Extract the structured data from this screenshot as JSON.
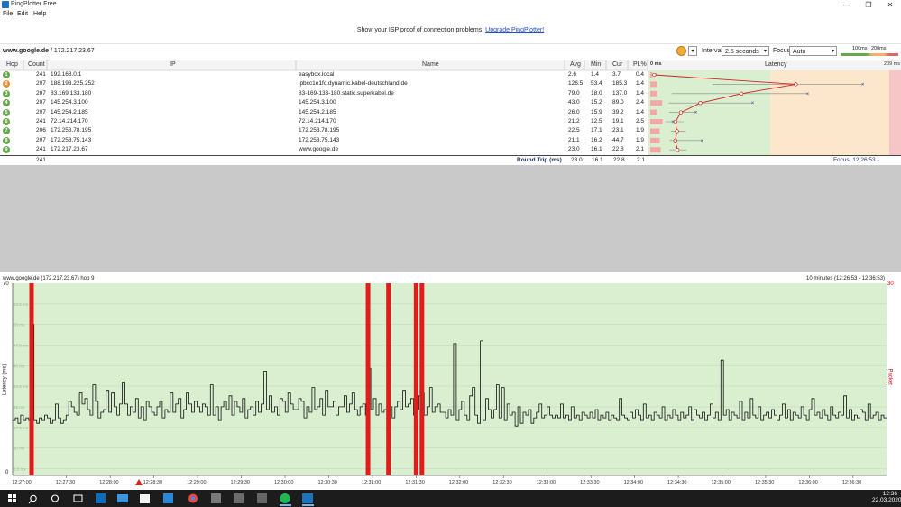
{
  "window": {
    "title": "PingPlotter Free",
    "min_icon": "—",
    "max_icon": "❐",
    "close_icon": "✕"
  },
  "menu": [
    "File",
    "Edit",
    "Help"
  ],
  "banner": {
    "text": "Show your ISP proof of connection problems.",
    "link": "Upgrade PingPlotter!"
  },
  "target": {
    "host": "www.google.de",
    "ip": " / 172.217.23.67"
  },
  "controls": {
    "interval_label": "Interval",
    "interval_value": "2.5 seconds",
    "focus_label": "Focus",
    "focus_value": "Auto",
    "legend_100": "100ms",
    "legend_200": "200ms"
  },
  "columns": {
    "hop": "Hop",
    "count": "Count",
    "ip": "IP",
    "name": "Name",
    "avg": "Avg",
    "min": "Min",
    "cur": "Cur",
    "pl": "PL%",
    "zero": "0 ms",
    "latency": "Latency",
    "max": "209 ms"
  },
  "colors": {
    "good": "#d9efd0",
    "warn": "#fde7cc",
    "bad": "#f6c6c6",
    "hop_green": "#6aa84f",
    "hop_orange": "#e69138",
    "loss": "#e21b1b"
  },
  "hops": [
    {
      "hop": "1",
      "count": "241",
      "ip": "192.168.0.1",
      "name": "easybox.local",
      "avg": "2.6",
      "min": "1.4",
      "cur": "3.7",
      "pl": "0.4",
      "color": "green"
    },
    {
      "hop": "2",
      "count": "207",
      "ip": "188.193.225.252",
      "name": "ipbcc1e1fc.dynamic.kabel-deutschland.de",
      "avg": "126.5",
      "min": "53.4",
      "cur": "185.3",
      "pl": "1.4",
      "color": "orange"
    },
    {
      "hop": "3",
      "count": "207",
      "ip": "83.169.133.180",
      "name": "83-169-133-180.static.superkabel.de",
      "avg": "79.0",
      "min": "18.0",
      "cur": "137.0",
      "pl": "1.4",
      "color": "green"
    },
    {
      "hop": "4",
      "count": "207",
      "ip": "145.254.3.100",
      "name": "145.254.3.100",
      "avg": "43.0",
      "min": "15.2",
      "cur": "89.0",
      "pl": "2.4",
      "color": "green"
    },
    {
      "hop": "5",
      "count": "207",
      "ip": "145.254.2.185",
      "name": "145.254.2.185",
      "avg": "26.0",
      "min": "15.9",
      "cur": "39.2",
      "pl": "1.4",
      "color": "green"
    },
    {
      "hop": "6",
      "count": "241",
      "ip": "72.14.214.170",
      "name": "72.14.214.170",
      "avg": "21.2",
      "min": "12.5",
      "cur": "19.1",
      "pl": "2.5",
      "color": "green"
    },
    {
      "hop": "7",
      "count": "206",
      "ip": "172.253.78.195",
      "name": "172.253.78.195",
      "avg": "22.5",
      "min": "17.1",
      "cur": "23.1",
      "pl": "1.9",
      "color": "green"
    },
    {
      "hop": "8",
      "count": "207",
      "ip": "172.253.75.143",
      "name": "172.253.75.143",
      "avg": "21.1",
      "min": "16.2",
      "cur": "44.7",
      "pl": "1.9",
      "color": "green"
    },
    {
      "hop": "9",
      "count": "241",
      "ip": "172.217.23.67",
      "name": "www.google.de",
      "avg": "23.0",
      "min": "16.1",
      "cur": "22.8",
      "pl": "2.1",
      "color": "green"
    }
  ],
  "roundtrip": {
    "count": "241",
    "label": "Round Trip (ms)",
    "avg": "23.0",
    "min": "16.1",
    "cur": "22.8",
    "pl": "2.1",
    "focus": "Focus: 12:26:53 - 12:36:53"
  },
  "graph": {
    "title": "www.google.de (172.217.23.67) hop 9",
    "range": "10 minutes (12:26:53 - 12:36:53)",
    "ylabel": "Latency (ms)",
    "y2label": "Packet Loss %",
    "ymax_label": "70",
    "ymin_label": "0",
    "y2max_label": "30"
  },
  "chart_data": {
    "type": "line",
    "title": "www.google.de (172.217.23.67) hop 9",
    "ylabel": "Latency (ms)",
    "y2label": "Packet Loss %",
    "ylim": [
      0,
      70
    ],
    "y2lim": [
      0,
      30
    ],
    "grid": true,
    "gridlines": [
      "62.5 ms",
      "55 ms",
      "47.5 ms",
      "40 ms",
      "32.5 ms",
      "25 ms",
      "17.5 ms",
      "10 ms",
      "2.5 ms"
    ],
    "x_ticks": [
      "12:27:00",
      "12:27:30",
      "12:28:00",
      "12:28:30",
      "12:29:00",
      "12:29:30",
      "12:30:00",
      "12:30:30",
      "12:31:00",
      "12:31:30",
      "12:32:00",
      "12:32:30",
      "12:33:00",
      "12:33:30",
      "12:34:00",
      "12:34:30",
      "12:35:00",
      "12:35:30",
      "12:36:00",
      "12:36:30"
    ],
    "loss_events": [
      "12:27:06",
      "12:30:57",
      "12:31:11",
      "12:31:30",
      "12:31:34"
    ],
    "latency": [
      20,
      21,
      19,
      22,
      20,
      21,
      20,
      55,
      20,
      19,
      21,
      20,
      22,
      21,
      19,
      20,
      26,
      21,
      19,
      20,
      22,
      27,
      25,
      23,
      22,
      30,
      26,
      28,
      24,
      22,
      33,
      27,
      21,
      23,
      24,
      31,
      23,
      30,
      25,
      22,
      26,
      34,
      26,
      22,
      25,
      23,
      28,
      21,
      25,
      20,
      27,
      25,
      23,
      22,
      25,
      27,
      21,
      24,
      23,
      30,
      23,
      26,
      28,
      21,
      24,
      30,
      26,
      23,
      27,
      25,
      23,
      26,
      25,
      22,
      33,
      22,
      25,
      20,
      25,
      27,
      24,
      29,
      22,
      27,
      25,
      23,
      28,
      21,
      24,
      25,
      22,
      27,
      23,
      26,
      38,
      24,
      29,
      23,
      25,
      22,
      28,
      27,
      23,
      30,
      26,
      24,
      24,
      28,
      27,
      21,
      25,
      23,
      32,
      24,
      25,
      28,
      22,
      31,
      25,
      25,
      27,
      22,
      25,
      25,
      29,
      23,
      26,
      30,
      24,
      22,
      25,
      26,
      22,
      39,
      24,
      28,
      22,
      26,
      23,
      24,
      29,
      25,
      21,
      25,
      27,
      24,
      31,
      25,
      26,
      28,
      22,
      24,
      29,
      30,
      22,
      25,
      32,
      23,
      25,
      26,
      23,
      23,
      21,
      24,
      22,
      48,
      20,
      24,
      27,
      22,
      20,
      29,
      32,
      22,
      19,
      49,
      20,
      28,
      24,
      21,
      24,
      33,
      21,
      32,
      20,
      26,
      22,
      23,
      18,
      25,
      19,
      23,
      22,
      24,
      19,
      21,
      23,
      26,
      21,
      22,
      25,
      22,
      21,
      22,
      21,
      26,
      21,
      22,
      20,
      25,
      21,
      22,
      20,
      23,
      22,
      21,
      23,
      21,
      24,
      20,
      22,
      21,
      23,
      20,
      22,
      21,
      20,
      28,
      22,
      21,
      20,
      23,
      21,
      24,
      22,
      20,
      26,
      21,
      22,
      20,
      23,
      22,
      21,
      25,
      20,
      22,
      21,
      24,
      22,
      20,
      23,
      21,
      22,
      25,
      20,
      24,
      22,
      21,
      23,
      20,
      22,
      26,
      21,
      23,
      20,
      42,
      22,
      24,
      20,
      23,
      22,
      21,
      27,
      20,
      23,
      21,
      28,
      22,
      21,
      25,
      20,
      22,
      23,
      21,
      24,
      22,
      20,
      22,
      26,
      21,
      24,
      20,
      23,
      22,
      21,
      25,
      22,
      20,
      24,
      28,
      22,
      23,
      21,
      24,
      22,
      20,
      25,
      22,
      21,
      23,
      22,
      29,
      21,
      24,
      20,
      22,
      21,
      24,
      23,
      20,
      26,
      21,
      22,
      23,
      20,
      22,
      21
    ]
  }
}
